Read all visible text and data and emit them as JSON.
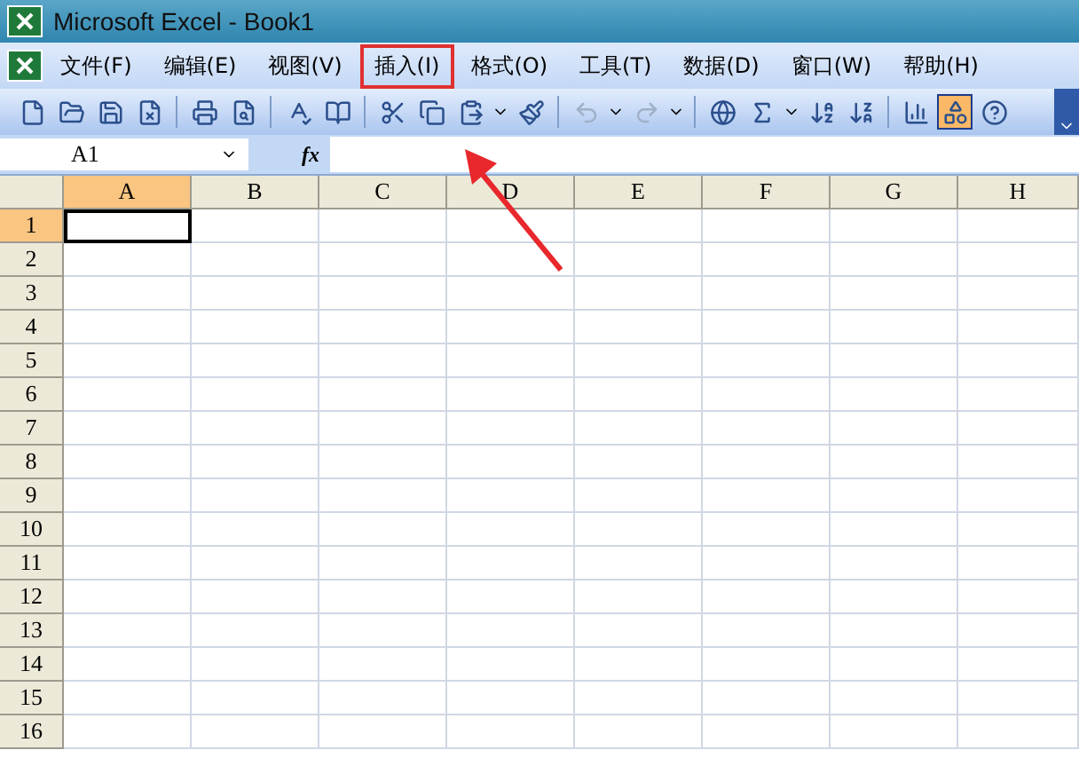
{
  "window": {
    "title": "Microsoft Excel - Book1"
  },
  "menu": [
    {
      "label": "文件(F)",
      "annotated": false
    },
    {
      "label": "编辑(E)",
      "annotated": false
    },
    {
      "label": "视图(V)",
      "annotated": false
    },
    {
      "label": "插入(I)",
      "annotated": true
    },
    {
      "label": "格式(O)",
      "annotated": false
    },
    {
      "label": "工具(T)",
      "annotated": false
    },
    {
      "label": "数据(D)",
      "annotated": false
    },
    {
      "label": "窗口(W)",
      "annotated": false
    },
    {
      "label": "帮助(H)",
      "annotated": false
    }
  ],
  "toolbar": [
    {
      "pressed": false,
      "disabled": false
    },
    {
      "pressed": false,
      "disabled": false
    },
    {
      "pressed": false,
      "disabled": false
    },
    {
      "pressed": false,
      "disabled": false
    },
    {
      "pressed": false,
      "disabled": false
    },
    {
      "pressed": false,
      "disabled": false
    },
    {
      "pressed": false,
      "disabled": false
    },
    {
      "pressed": false,
      "disabled": false
    },
    {
      "pressed": false,
      "disabled": false
    },
    {
      "pressed": false,
      "disabled": false
    },
    {
      "pressed": false,
      "disabled": false
    },
    {
      "pressed": false,
      "disabled": false
    },
    {
      "pressed": false,
      "disabled": true
    },
    {
      "pressed": false,
      "disabled": true
    },
    {
      "pressed": false,
      "disabled": false
    },
    {
      "pressed": false,
      "disabled": false
    },
    {
      "pressed": false,
      "disabled": false
    },
    {
      "pressed": false,
      "disabled": false
    },
    {
      "pressed": false,
      "disabled": false
    },
    {
      "pressed": true,
      "disabled": false
    },
    {
      "pressed": false,
      "disabled": false
    }
  ],
  "formula_bar": {
    "name_box": "A1",
    "fx": "fx"
  },
  "sheet": {
    "columns": [
      {
        "label": "A",
        "selected": true
      },
      {
        "label": "B",
        "selected": false
      },
      {
        "label": "C",
        "selected": false
      },
      {
        "label": "D",
        "selected": false
      },
      {
        "label": "E",
        "selected": false
      },
      {
        "label": "F",
        "selected": false
      },
      {
        "label": "G",
        "selected": false
      },
      {
        "label": "H",
        "selected": false
      }
    ],
    "rows": [
      {
        "label": "1",
        "selected": true
      },
      {
        "label": "2",
        "selected": false
      },
      {
        "label": "3",
        "selected": false
      },
      {
        "label": "4",
        "selected": false
      },
      {
        "label": "5",
        "selected": false
      },
      {
        "label": "6",
        "selected": false
      },
      {
        "label": "7",
        "selected": false
      },
      {
        "label": "8",
        "selected": false
      },
      {
        "label": "9",
        "selected": false
      },
      {
        "label": "10",
        "selected": false
      },
      {
        "label": "11",
        "selected": false
      },
      {
        "label": "12",
        "selected": false
      },
      {
        "label": "13",
        "selected": false
      },
      {
        "label": "14",
        "selected": false
      },
      {
        "label": "15",
        "selected": false
      },
      {
        "label": "16",
        "selected": false
      }
    ]
  }
}
